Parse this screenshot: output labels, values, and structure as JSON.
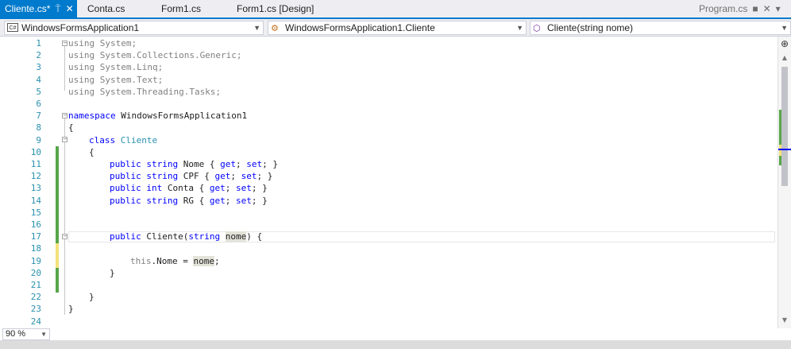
{
  "tabs": {
    "active": {
      "label": "Cliente.cs*",
      "pin_icon": "⍑",
      "close_icon": "✕"
    },
    "items": [
      {
        "label": "Conta.cs"
      },
      {
        "label": "Form1.cs"
      },
      {
        "label": "Form1.cs [Design]"
      }
    ],
    "right": {
      "label": "Program.cs",
      "pin_icon": "■",
      "close_icon": "✕",
      "menu_icon": "▾"
    }
  },
  "navbar": {
    "project": {
      "icon": "C#",
      "label": "WindowsFormsApplication1"
    },
    "type": {
      "label": "WindowsFormsApplication1.Cliente"
    },
    "member": {
      "label": "Cliente(string nome)"
    }
  },
  "editor": {
    "line_numbers": [
      "1",
      "2",
      "3",
      "4",
      "5",
      "6",
      "7",
      "8",
      "9",
      "10",
      "11",
      "12",
      "13",
      "14",
      "15",
      "16",
      "17",
      "18",
      "19",
      "20",
      "21",
      "22",
      "23",
      "24"
    ],
    "current_line": 17,
    "code": {
      "l1": "using System;",
      "l2": "using System.Collections.Generic;",
      "l3": "using System.Linq;",
      "l4": "using System.Text;",
      "l5": "using System.Threading.Tasks;",
      "l7_kw": "namespace",
      "l7_name": " WindowsFormsApplication1",
      "l8": "{",
      "l9_kw": "class",
      "l9_name": "Cliente",
      "l10": "{",
      "l11": {
        "kw1": "public",
        "kw2": "string",
        "name": " Nome { ",
        "get": "get",
        "sep": "; ",
        "set": "set",
        "end": "; }"
      },
      "l12": {
        "kw1": "public",
        "kw2": "string",
        "name": " CPF { ",
        "get": "get",
        "sep": "; ",
        "set": "set",
        "end": "; }"
      },
      "l13": {
        "kw1": "public",
        "kw2": "int",
        "name": " Conta { ",
        "get": "get",
        "sep": "; ",
        "set": "set",
        "end": "; }"
      },
      "l14": {
        "kw1": "public",
        "kw2": "string",
        "name": " RG { ",
        "get": "get",
        "sep": "; ",
        "set": "set",
        "end": "; }"
      },
      "l17": {
        "kw1": "public",
        "name": " Cliente(",
        "kw2": "string",
        "param": "nome",
        "end": ") {"
      },
      "l19": {
        "kw": "this",
        "mid": ".Nome = ",
        "param": "nome",
        "end": ";"
      },
      "l20": "}",
      "l22": "}",
      "l23": "}"
    }
  },
  "status": {
    "zoom": "90 %"
  },
  "colors": {
    "accent": "#007acc",
    "keyword": "#0000ff",
    "type": "#2b91af",
    "saved_change": "#57a64a",
    "unsaved_change": "#f4e27b"
  }
}
